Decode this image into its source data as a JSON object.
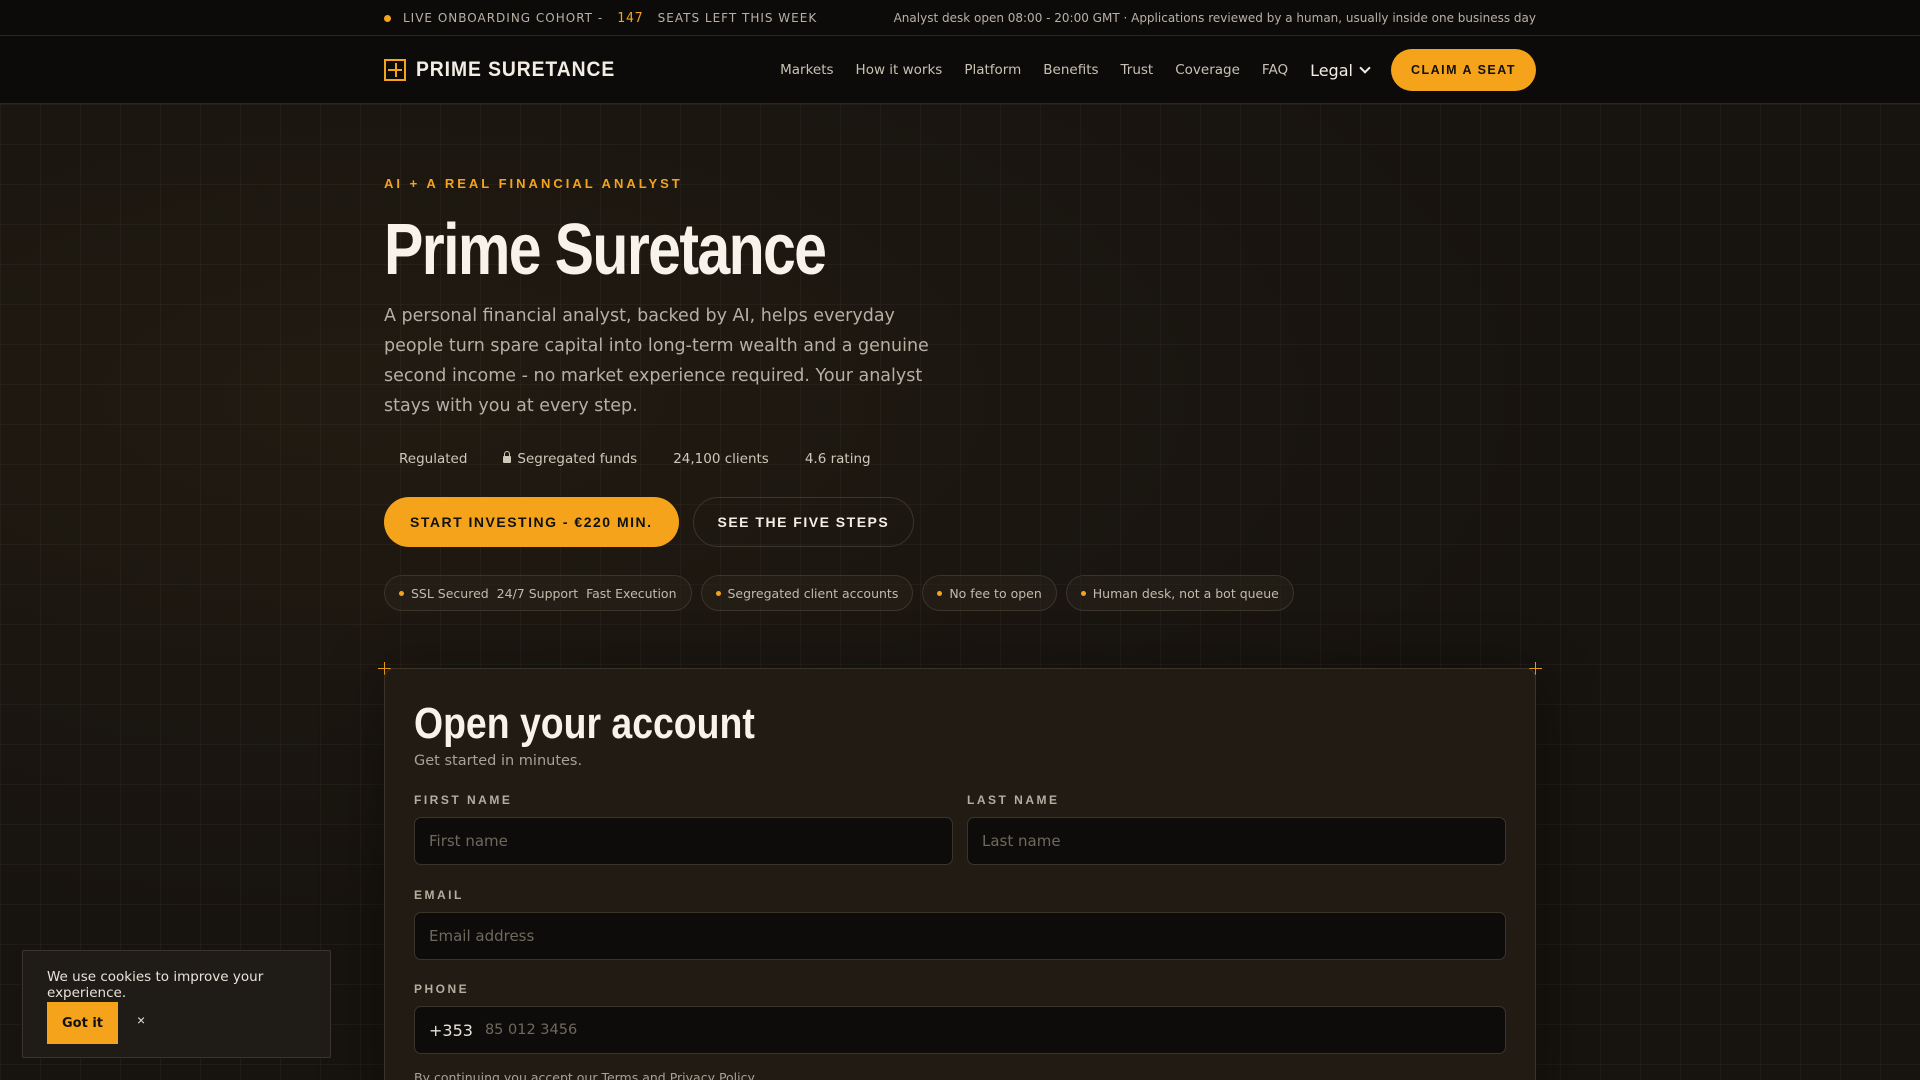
{
  "topbar": {
    "cohort_label": "LIVE ONBOARDING COHORT -",
    "seats_count": "147",
    "seats_label": "SEATS LEFT THIS WEEK",
    "desk_hours": "Analyst desk open 08:00 - 20:00 GMT · Applications reviewed by a human, usually inside one business day"
  },
  "nav": {
    "brand": "PRIME SURETANCE",
    "items": [
      "Markets",
      "How it works",
      "Platform",
      "Benefits",
      "Trust",
      "Coverage",
      "FAQ"
    ],
    "legal": "Legal",
    "claim": "CLAIM A SEAT"
  },
  "hero": {
    "eyebrow": "AI + A REAL FINANCIAL ANALYST",
    "title": "Prime Suretance",
    "lead": "A personal financial analyst, backed by AI, helps everyday people turn spare capital into long-term wealth and a genuine second income - no market experience required. Your analyst stays with you at every step.",
    "stats": [
      "Regulated",
      "Segregated funds",
      "24,100 clients",
      "4.6 rating"
    ],
    "cta_primary": "START INVESTING - €220 MIN.",
    "cta_secondary": "SEE THE FIVE STEPS",
    "chips": [
      "SSL Secured  24/7 Support  Fast Execution",
      "Segregated client accounts",
      "No fee to open",
      "Human desk, not a bot queue"
    ]
  },
  "form": {
    "title": "Open your account",
    "subtitle": "Get started in minutes.",
    "first_name_label": "FIRST NAME",
    "first_name_placeholder": "First name",
    "last_name_label": "LAST NAME",
    "last_name_placeholder": "Last name",
    "email_label": "EMAIL",
    "email_placeholder": "Email address",
    "phone_label": "PHONE",
    "phone_code": "+353",
    "phone_placeholder": "85 012 3456",
    "consent": "By continuing you accept our Terms and Privacy Policy."
  },
  "cookie": {
    "message": "We use cookies to improve your experience.",
    "accept": "Got it",
    "close": "×"
  },
  "colors": {
    "accent": "#f5a31b",
    "background": "#161310",
    "card": "#211b14"
  }
}
